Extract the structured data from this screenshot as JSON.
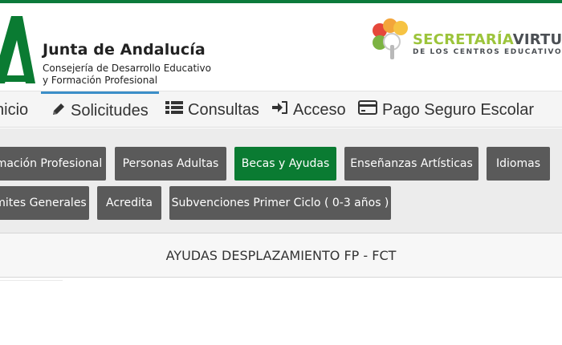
{
  "header": {
    "org_title": "Junta de Andalucía",
    "org_sub1": "Consejería de Desarrollo Educativo",
    "org_sub2": "y Formación Profesional",
    "secretaria_green": "SECRETARÍA",
    "secretaria_grey": "VIRTUAL",
    "secretaria_sub": "DE LOS CENTROS EDUCATIVOS"
  },
  "nav": {
    "inicio": "nicio",
    "solicitudes": "Solicitudes",
    "consultas": "Consultas",
    "acceso": "Acceso",
    "pago": "Pago Seguro Escolar"
  },
  "tabs": {
    "fp": "mación Profesional",
    "adultas": "Personas Adultas",
    "becas": "Becas y Ayudas",
    "artisticas": "Enseñanzas Artísticas",
    "idiomas": "Idiomas",
    "tramites": "mites Generales",
    "acredita": "Acredita",
    "subvenciones": "Subvenciones Primer Ciclo ( 0-3 años )"
  },
  "section": {
    "title": "AYUDAS DESPLAZAMIENTO FP - FCT"
  },
  "colors": {
    "brand_green": "#0b7a3b",
    "active_tab": "#0a7b32",
    "tab_grey": "#5a5a5a",
    "accent_blue": "#3b8ec8"
  }
}
